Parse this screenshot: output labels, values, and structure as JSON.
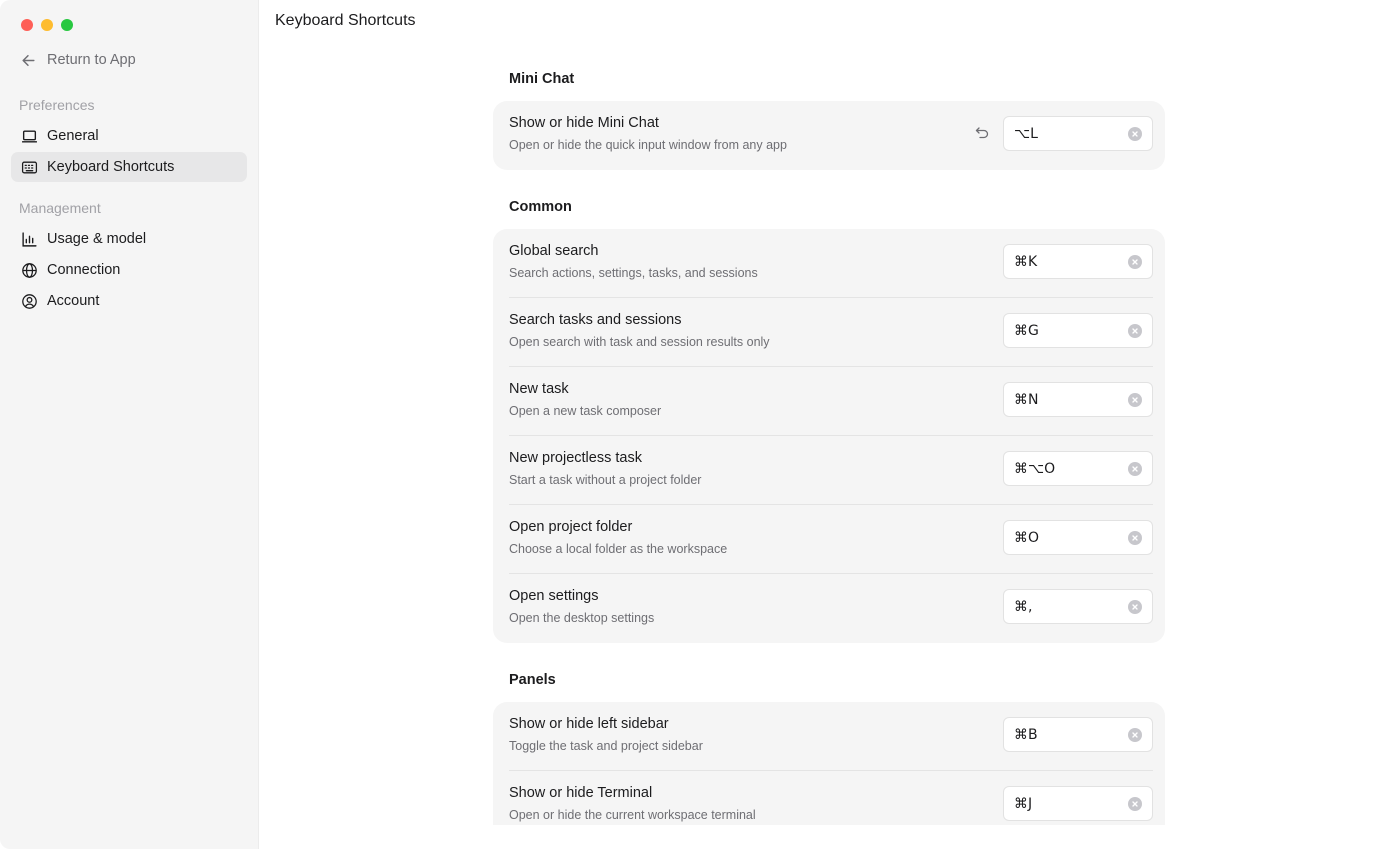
{
  "sidebar": {
    "return_label": "Return to App",
    "preferences_label": "Preferences",
    "management_label": "Management",
    "items": [
      {
        "label": "General",
        "icon": "laptop-icon"
      },
      {
        "label": "Keyboard Shortcuts",
        "icon": "keyboard-icon"
      },
      {
        "label": "Usage & model",
        "icon": "bar-chart-icon"
      },
      {
        "label": "Connection",
        "icon": "globe-icon"
      },
      {
        "label": "Account",
        "icon": "user-circle-icon"
      }
    ]
  },
  "main": {
    "title": "Keyboard Shortcuts",
    "groups": [
      {
        "title": "Mini Chat",
        "rows": [
          {
            "label": "Show or hide Mini Chat",
            "desc": "Open or hide the quick input window from any app",
            "keys": "⌥L"
          }
        ]
      },
      {
        "title": "Common",
        "rows": [
          {
            "label": "Global search",
            "desc": "Search actions, settings, tasks, and sessions",
            "keys": "⌘K"
          },
          {
            "label": "Search tasks and sessions",
            "desc": "Open search with task and session results only",
            "keys": "⌘G"
          },
          {
            "label": "New task",
            "desc": "Open a new task composer",
            "keys": "⌘N"
          },
          {
            "label": "New projectless task",
            "desc": "Start a task without a project folder",
            "keys": "⌘⌥O"
          },
          {
            "label": "Open project folder",
            "desc": "Choose a local folder as the workspace",
            "keys": "⌘O"
          },
          {
            "label": "Open settings",
            "desc": "Open the desktop settings",
            "keys": "⌘,"
          }
        ]
      },
      {
        "title": "Panels",
        "rows": [
          {
            "label": "Show or hide left sidebar",
            "desc": "Toggle the task and project sidebar",
            "keys": "⌘B"
          },
          {
            "label": "Show or hide Terminal",
            "desc": "Open or hide the current workspace terminal",
            "keys": "⌘J"
          }
        ]
      }
    ]
  }
}
